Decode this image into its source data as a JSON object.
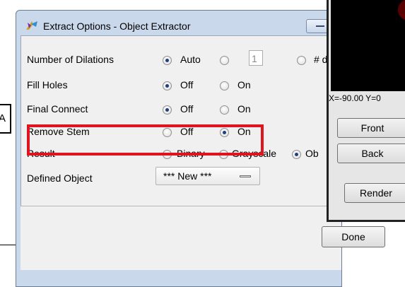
{
  "callout": {
    "letter": "A"
  },
  "dialog": {
    "title": "Extract Options - Object Extractor",
    "rows": [
      {
        "label": "Number of Dilations",
        "options": [
          "Auto",
          "",
          "# d"
        ],
        "selected": 0,
        "value": "1"
      },
      {
        "label": "Fill Holes",
        "options": [
          "Off",
          "On"
        ],
        "selected": 0
      },
      {
        "label": "Final Connect",
        "options": [
          "Off",
          "On"
        ],
        "selected": 0
      },
      {
        "label": "Remove Stem",
        "options": [
          "Off",
          "On"
        ],
        "selected": 1
      },
      {
        "label": "Result",
        "options": [
          "Binary",
          "Grayscale",
          "Ob"
        ],
        "selected": 2
      },
      {
        "label": "Defined Object"
      }
    ],
    "defined_object_select": "*** New ***",
    "done_label": "Done"
  },
  "side_window": {
    "coord_text": "X=-90.00 Y=0",
    "buttons": [
      "Front",
      "Back",
      "Render"
    ]
  },
  "colors": {
    "highlight": "#e0141e",
    "title_bar": "#c9d8ea"
  }
}
